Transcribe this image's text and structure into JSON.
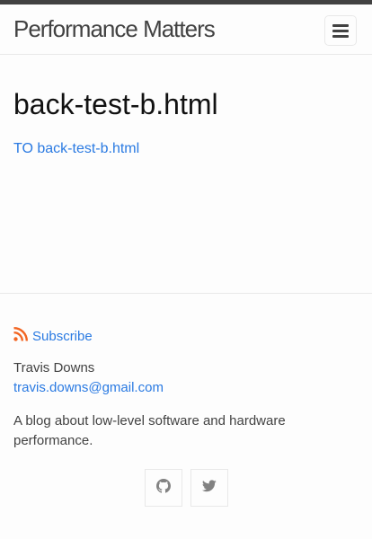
{
  "header": {
    "site_title": "Performance Matters",
    "menu_icon": "hamburger-menu-icon"
  },
  "main": {
    "title": "back-test-b.html",
    "link_text": "TO back-test-b.html"
  },
  "footer": {
    "subscribe_icon": "rss-icon",
    "subscribe_label": "Subscribe",
    "author_name": "Travis Downs",
    "author_email": "travis.downs@gmail.com",
    "description": "A blog about low-level software and hardware performance.",
    "social": [
      {
        "icon": "github-icon"
      },
      {
        "icon": "twitter-icon"
      }
    ]
  },
  "colors": {
    "link": "#2a7ae2",
    "topbar": "#424242",
    "rss": "#f26522",
    "border": "#e8e8e8"
  }
}
